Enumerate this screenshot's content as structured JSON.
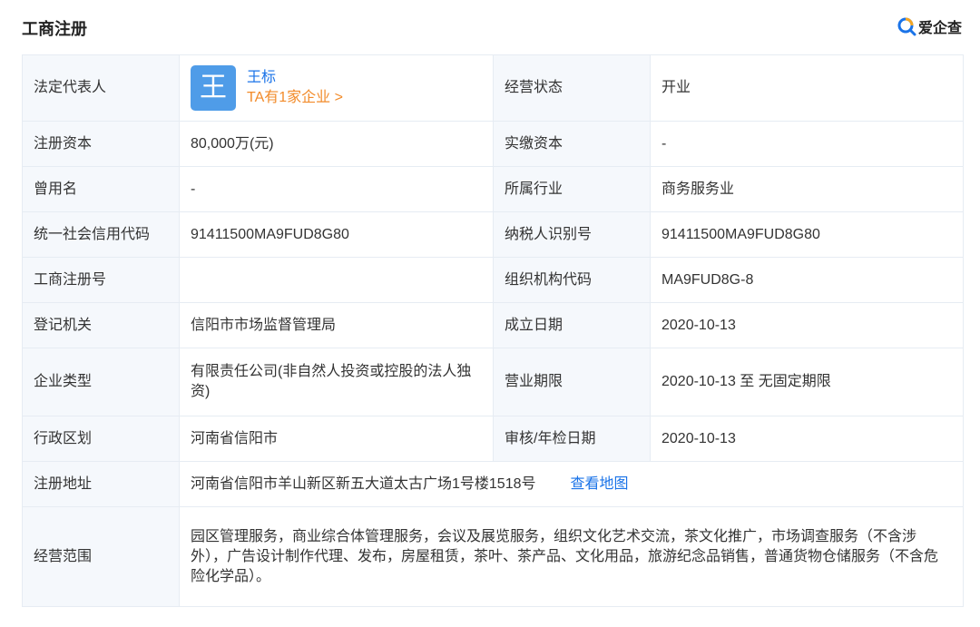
{
  "header": {
    "title": "工商注册",
    "brand": "爱企查",
    "brand_color": "#1a73e8",
    "brand_icon": "search-magnifier-icon"
  },
  "representative": {
    "label": "法定代表人",
    "avatar_char": "王",
    "avatar_color": "#4f9ce8",
    "name": "王标",
    "link": "TA有1家企业 >"
  },
  "status": {
    "label": "经营状态",
    "value": "开业"
  },
  "rows": [
    {
      "left_label": "注册资本",
      "left_value": "80,000万(元)",
      "right_label": "实缴资本",
      "right_value": "-"
    },
    {
      "left_label": "曾用名",
      "left_value": "-",
      "right_label": "所属行业",
      "right_value": "商务服务业"
    },
    {
      "left_label": "统一社会信用代码",
      "left_value": "91411500MA9FUD8G80",
      "right_label": "纳税人识别号",
      "right_value": "91411500MA9FUD8G80"
    },
    {
      "left_label": "工商注册号",
      "left_value": "",
      "right_label": "组织机构代码",
      "right_value": "MA9FUD8G-8"
    },
    {
      "left_label": "登记机关",
      "left_value": "信阳市市场监督管理局",
      "right_label": "成立日期",
      "right_value": "2020-10-13"
    },
    {
      "left_label": "企业类型",
      "left_value": "有限责任公司(非自然人投资或控股的法人独资)",
      "right_label": "营业期限",
      "right_value": "2020-10-13 至 无固定期限"
    },
    {
      "left_label": "行政区划",
      "left_value": "河南省信阳市",
      "right_label": "审核/年检日期",
      "right_value": "2020-10-13"
    }
  ],
  "address": {
    "label": "注册地址",
    "value": "河南省信阳市羊山新区新五大道太古广场1号楼1518号",
    "map_link": "查看地图"
  },
  "scope": {
    "label": "经营范围",
    "value": "园区管理服务，商业综合体管理服务，会议及展览服务，组织文化艺术交流，茶文化推广，市场调查服务（不含涉外），广告设计制作代理、发布，房屋租赁，茶叶、茶产品、文化用品，旅游纪念品销售，普通货物仓储服务（不含危险化学品）。"
  }
}
